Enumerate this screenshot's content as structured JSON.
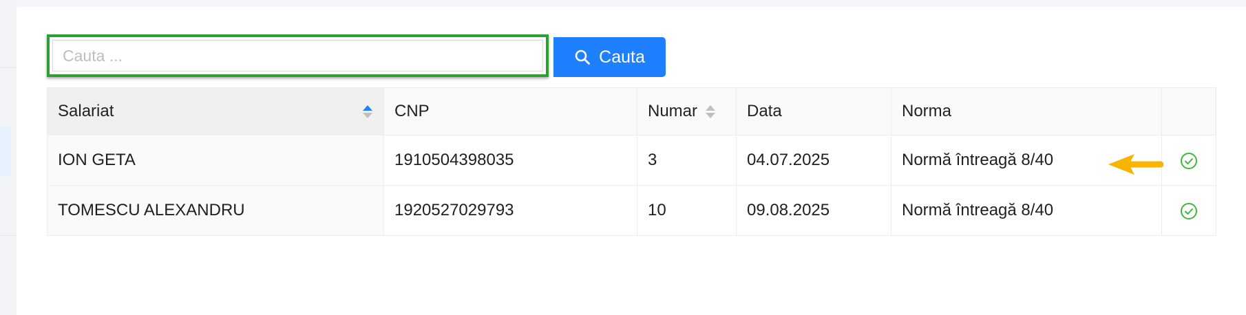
{
  "search": {
    "placeholder": "Cauta ...",
    "value": "",
    "button_label": "Cauta"
  },
  "table": {
    "columns": [
      {
        "label": "Salariat",
        "sortable": true,
        "sort": "ascending"
      },
      {
        "label": "CNP",
        "sortable": false
      },
      {
        "label": "Numar",
        "sortable": true,
        "sort": "none"
      },
      {
        "label": "Data",
        "sortable": false
      },
      {
        "label": "Norma",
        "sortable": false
      },
      {
        "label": "",
        "sortable": false
      }
    ],
    "rows": [
      {
        "salariat": "ION GETA",
        "cnp": "1910504398035",
        "numar": "3",
        "data": "04.07.2025",
        "norma": "Normă întreagă 8/40",
        "action_icon": "check-circle-icon"
      },
      {
        "salariat": "TOMESCU ALEXANDRU",
        "cnp": "1920527029793",
        "numar": "10",
        "data": "09.08.2025",
        "norma": "Normă întreagă 8/40",
        "action_icon": "check-circle-icon"
      }
    ]
  },
  "colors": {
    "accent": "#1f80ff",
    "highlight_border": "#2f9e33",
    "check_icon": "#3db83d",
    "annotation_arrow": "#f7b500",
    "sort_active": "#1f80ff"
  }
}
